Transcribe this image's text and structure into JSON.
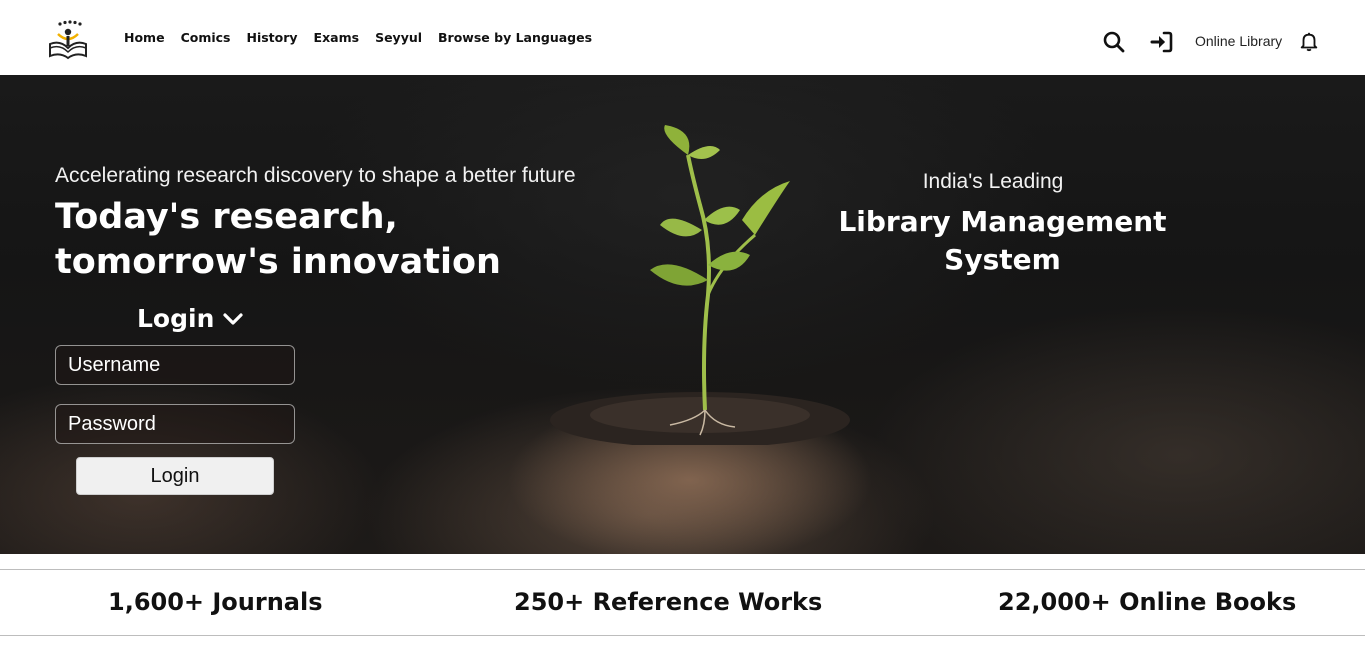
{
  "header": {
    "nav": [
      "Home",
      "Comics",
      "History",
      "Exams",
      "Seyyul",
      "Browse by Languages"
    ],
    "online_library": "Online Library"
  },
  "hero": {
    "tagline": "Accelerating research discovery to shape a better future",
    "headline": "Today's research, tomorrow's innovation",
    "login_toggle": "Login",
    "username_placeholder": "Username",
    "password_placeholder": "Password",
    "login_button": "Login",
    "lead_small": "India's Leading",
    "lead_big": "Library Management System"
  },
  "stats": {
    "journals": "1,600+ Journals",
    "reference": "250+ Reference Works",
    "books": "22,000+ Online Books"
  },
  "icons": {
    "logo": "book-reader-logo",
    "search": "search-icon",
    "login": "sign-in-icon",
    "notification": "bell-icon",
    "chevron": "chevron-down-icon"
  }
}
